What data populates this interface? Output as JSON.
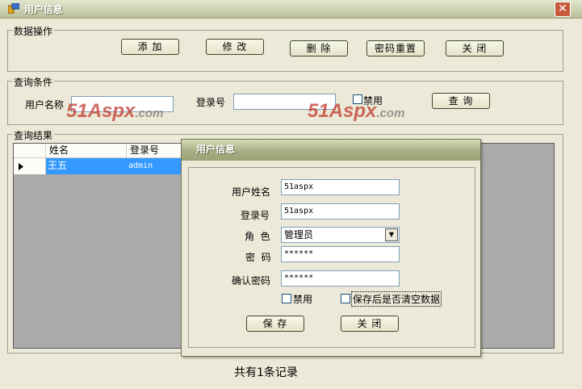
{
  "window": {
    "title": "用户信息"
  },
  "data_ops": {
    "legend": "数据操作",
    "buttons": {
      "add": "添 加",
      "edit": "修 改",
      "delete": "删 除",
      "reset_pwd": "密码重置",
      "close": "关 闭"
    }
  },
  "query": {
    "legend": "查询条件",
    "username_label": "用户名称",
    "username_value": "",
    "login_label": "登录号",
    "login_value": "",
    "disabled_label": "禁用",
    "disabled_checked": false,
    "search_button": "查 询"
  },
  "watermark": {
    "main": "51Aspx",
    "suffix": ".com"
  },
  "results": {
    "legend": "查询结果",
    "columns": [
      "姓名",
      "登录号"
    ],
    "rows": [
      {
        "name": "王五",
        "login": "admin",
        "selected": true
      }
    ],
    "record_count_text": "共有1条记录"
  },
  "dialog": {
    "title": "用户信息",
    "name_label": "用户姓名",
    "name_value": "51aspx",
    "login_label": "登录号",
    "login_value": "51aspx",
    "role_label": "角  色",
    "role_value": "管理员",
    "password_label": "密  码",
    "password_value": "******",
    "confirm_label": "确认密码",
    "confirm_value": "******",
    "disabled_label": "禁用",
    "clear_label": "保存后是否清空数据",
    "save_button": "保 存",
    "close_button": "关 闭"
  },
  "colors": {
    "selection": "#3399ff",
    "title_close": "#c85a3c",
    "watermark": "#c0392b"
  },
  "icons": {
    "app": "app-window-icon",
    "close": "close-icon",
    "combo": "dropdown-arrow-icon",
    "row_pointer": "row-pointer-icon"
  }
}
